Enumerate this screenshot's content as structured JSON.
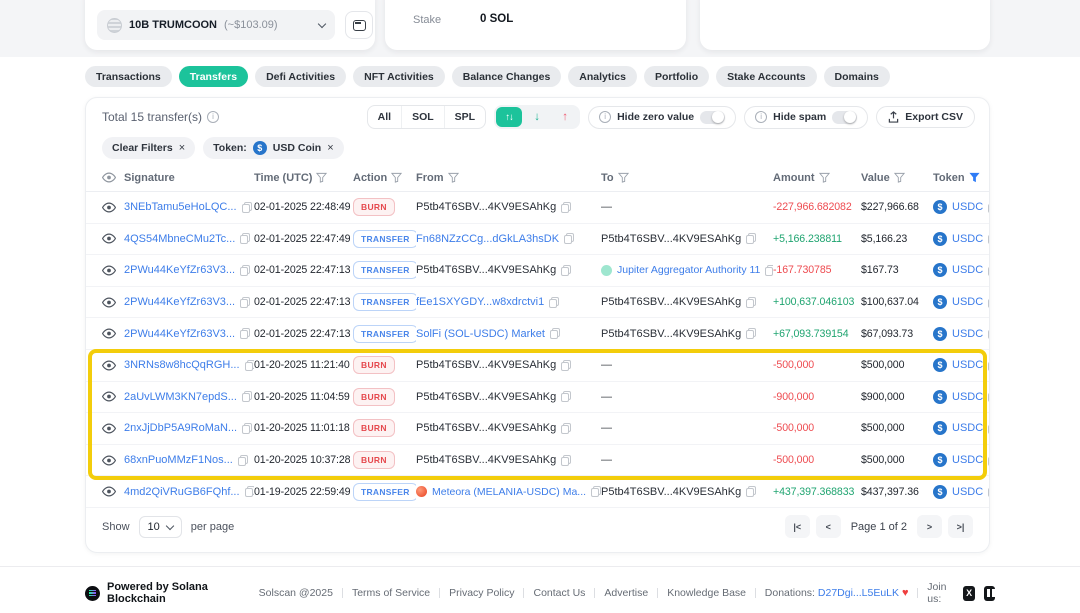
{
  "header": {
    "token_selector": {
      "name": "10B TRUMCOON",
      "price": "(~$103.09)"
    },
    "stake": {
      "label": "Stake",
      "value": "0 SOL"
    }
  },
  "tabs": [
    {
      "label": "Transactions",
      "active": false
    },
    {
      "label": "Transfers",
      "active": true
    },
    {
      "label": "Defi Activities",
      "active": false
    },
    {
      "label": "NFT Activities",
      "active": false
    },
    {
      "label": "Balance Changes",
      "active": false
    },
    {
      "label": "Analytics",
      "active": false
    },
    {
      "label": "Portfolio",
      "active": false
    },
    {
      "label": "Stake Accounts",
      "active": false
    },
    {
      "label": "Domains",
      "active": false
    }
  ],
  "panel": {
    "total_text": "Total 15 transfer(s)",
    "scope_options": [
      "All",
      "SOL",
      "SPL"
    ],
    "toggles": [
      {
        "label": "Hide zero value",
        "on": false
      },
      {
        "label": "Hide spam",
        "on": false
      }
    ],
    "export_label": "Export CSV",
    "chips": [
      {
        "label": "Clear Filters"
      },
      {
        "prefix": "Token:",
        "label": "USD Coin",
        "icon": "usdc"
      }
    ]
  },
  "table": {
    "columns": [
      {
        "id": "visibility",
        "label": "",
        "icon": "eye-icon"
      },
      {
        "id": "signature",
        "label": "Signature"
      },
      {
        "id": "time",
        "label": "Time (UTC)",
        "filter": true
      },
      {
        "id": "action",
        "label": "Action",
        "filter": true
      },
      {
        "id": "from",
        "label": "From",
        "filter": true
      },
      {
        "id": "to",
        "label": "To",
        "filter": true
      },
      {
        "id": "amount",
        "label": "Amount",
        "filter": true
      },
      {
        "id": "value",
        "label": "Value",
        "filter": true
      },
      {
        "id": "token",
        "label": "Token",
        "filter": "active"
      }
    ],
    "rows": [
      {
        "signature": "3NEbTamu5eHoLQC...",
        "time": "02-01-2025 22:48:49",
        "action": "BURN",
        "from": {
          "text": "P5tb4T6SBV...4KV9ESAhKg",
          "link": false,
          "copy": true
        },
        "to": {
          "dash": true
        },
        "amount": "-227,966.682082",
        "value": "$227,966.68",
        "token": "USDC",
        "highlighted": false
      },
      {
        "signature": "4QS54MbneCMu2Tc...",
        "time": "02-01-2025 22:47:49",
        "action": "TRANSFER",
        "from": {
          "text": "Fn68NZzCCg...dGkLA3hsDK",
          "link": true,
          "copy": true
        },
        "to": {
          "text": "P5tb4T6SBV...4KV9ESAhKg",
          "link": false,
          "copy": true
        },
        "amount": "+5,166.238811",
        "value": "$5,166.23",
        "token": "USDC",
        "highlighted": false
      },
      {
        "signature": "2PWu44KeYfZr63V3...",
        "time": "02-01-2025 22:47:13",
        "action": "TRANSFER",
        "from": {
          "text": "P5tb4T6SBV...4KV9ESAhKg",
          "link": false,
          "copy": true
        },
        "to": {
          "text": "Jupiter Aggregator Authority 11",
          "link": true,
          "icon": "jupiter",
          "copy": true
        },
        "amount": "-167.730785",
        "value": "$167.73",
        "token": "USDC",
        "highlighted": false
      },
      {
        "signature": "2PWu44KeYfZr63V3...",
        "time": "02-01-2025 22:47:13",
        "action": "TRANSFER",
        "from": {
          "text": "fEe1SXYGDY...w8xdrctvi1",
          "link": true,
          "copy": true
        },
        "to": {
          "text": "P5tb4T6SBV...4KV9ESAhKg",
          "link": false,
          "copy": true
        },
        "amount": "+100,637.046103",
        "value": "$100,637.04",
        "token": "USDC",
        "highlighted": false
      },
      {
        "signature": "2PWu44KeYfZr63V3...",
        "time": "02-01-2025 22:47:13",
        "action": "TRANSFER",
        "from": {
          "text": "SolFi (SOL-USDC) Market",
          "link": true,
          "copy": true
        },
        "to": {
          "text": "P5tb4T6SBV...4KV9ESAhKg",
          "link": false,
          "copy": true
        },
        "amount": "+67,093.739154",
        "value": "$67,093.73",
        "token": "USDC",
        "highlighted": false
      },
      {
        "signature": "3NRNs8w8hcQqRGH...",
        "time": "01-20-2025 11:21:40",
        "action": "BURN",
        "from": {
          "text": "P5tb4T6SBV...4KV9ESAhKg",
          "link": false,
          "copy": true
        },
        "to": {
          "dash": true
        },
        "amount": "-500,000",
        "value": "$500,000",
        "token": "USDC",
        "highlighted": true
      },
      {
        "signature": "2aUvLWM3KN7epdS...",
        "time": "01-20-2025 11:04:59",
        "action": "BURN",
        "from": {
          "text": "P5tb4T6SBV...4KV9ESAhKg",
          "link": false,
          "copy": true
        },
        "to": {
          "dash": true
        },
        "amount": "-900,000",
        "value": "$900,000",
        "token": "USDC",
        "highlighted": true
      },
      {
        "signature": "2nxJjDbP5A9RoMaN...",
        "time": "01-20-2025 11:01:18",
        "action": "BURN",
        "from": {
          "text": "P5tb4T6SBV...4KV9ESAhKg",
          "link": false,
          "copy": true
        },
        "to": {
          "dash": true
        },
        "amount": "-500,000",
        "value": "$500,000",
        "token": "USDC",
        "highlighted": true
      },
      {
        "signature": "68xnPuoMMzF1Nos...",
        "time": "01-20-2025 10:37:28",
        "action": "BURN",
        "from": {
          "text": "P5tb4T6SBV...4KV9ESAhKg",
          "link": false,
          "copy": true
        },
        "to": {
          "dash": true
        },
        "amount": "-500,000",
        "value": "$500,000",
        "token": "USDC",
        "highlighted": true
      },
      {
        "signature": "4md2QiVRuGB6FQhf...",
        "time": "01-19-2025 22:59:49",
        "action": "TRANSFER",
        "from": {
          "text": "Meteora (MELANIA-USDC) Ma...",
          "link": true,
          "icon": "meteora",
          "copy": true
        },
        "to": {
          "text": "P5tb4T6SBV...4KV9ESAhKg",
          "link": false,
          "copy": true
        },
        "amount": "+437,397.368833",
        "value": "$437,397.36",
        "token": "USDC",
        "highlighted": false
      }
    ],
    "highlighted_rows": [
      6,
      7,
      8,
      9
    ]
  },
  "pagination": {
    "show_label": "Show",
    "page_size": "10",
    "per_page_label": "per page",
    "first": "|<",
    "prev": "<",
    "page_text": "Page 1 of 2",
    "next": ">",
    "last": ">|"
  },
  "footer": {
    "powered": "Powered by Solana Blockchain",
    "links": [
      "Solscan @2025",
      "Terms of Service",
      "Privacy Policy",
      "Contact Us",
      "Advertise",
      "Knowledge Base"
    ],
    "donations_label": "Donations:",
    "donations_address": "D27Dgi...L5EuLK",
    "join_label": "Join us:"
  },
  "colors": {
    "accent_green": "#1cc39b",
    "link_blue": "#3d7de9",
    "negative_red": "#ee4b50",
    "positive_green": "#1fa470",
    "highlight_yellow": "#f3cd0b",
    "usdc_blue": "#2775ca",
    "burn_red": "#e5484d",
    "transfer_blue": "#4a86ea"
  }
}
